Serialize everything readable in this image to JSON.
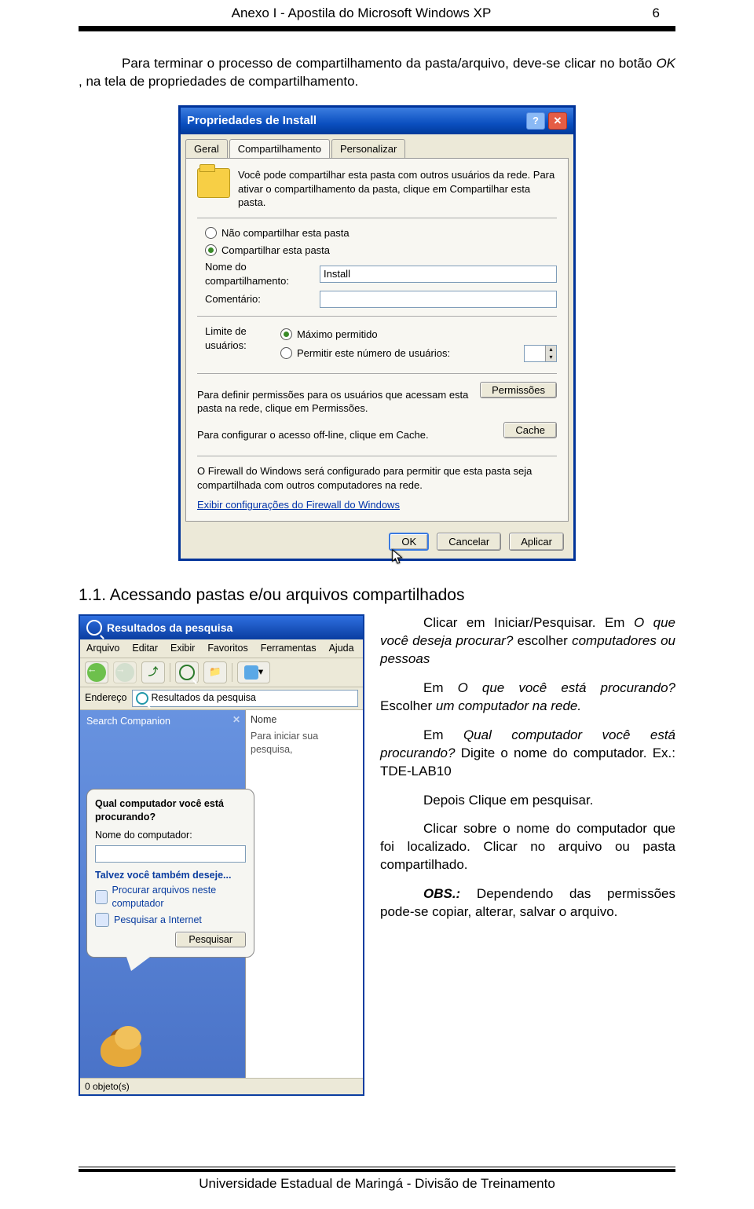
{
  "header": {
    "title": "Anexo I - Apostila do Microsoft Windows XP",
    "page": "6"
  },
  "intro": {
    "line1_pre": "Para terminar o processo de compartilhamento da pasta/arquivo, deve-se clicar no botão ",
    "line1_ok": "OK",
    "line1_post": ", na tela de propriedades de compartilhamento."
  },
  "dialog": {
    "title": "Propriedades de Install",
    "tabs": {
      "geral": "Geral",
      "compart": "Compartilhamento",
      "personal": "Personalizar"
    },
    "desc": "Você pode compartilhar esta pasta com outros usuários da rede. Para ativar o compartilhamento da pasta, clique em Compartilhar esta pasta.",
    "radio_no": "Não compartilhar esta pasta",
    "radio_yes": "Compartilhar esta pasta",
    "lbl_nome": "Nome do compartilhamento:",
    "val_nome": "Install",
    "lbl_coment": "Comentário:",
    "lbl_limite": "Limite de usuários:",
    "radio_max": "Máximo permitido",
    "radio_num": "Permitir este número de usuários:",
    "perm_text": "Para definir permissões para os usuários que acessam esta pasta na rede, clique em Permissões.",
    "btn_perm": "Permissões",
    "cache_text": "Para configurar o acesso off-line, clique em Cache.",
    "btn_cache": "Cache",
    "fw_text": "O Firewall do Windows será configurado para permitir que esta pasta seja compartilhada com outros computadores na rede.",
    "fw_link": "Exibir configurações do Firewall do Windows",
    "btn_ok": "OK",
    "btn_cancel": "Cancelar",
    "btn_apply": "Aplicar"
  },
  "h2": "1.1. Acessando pastas e/ou arquivos compartilhados",
  "search": {
    "title": "Resultados da pesquisa",
    "menu": {
      "arquivo": "Arquivo",
      "editar": "Editar",
      "exibir": "Exibir",
      "favoritos": "Favoritos",
      "ferramentas": "Ferramentas",
      "ajuda": "Ajuda"
    },
    "addr_label": "Endereço",
    "addr_value": "Resultados da pesquisa",
    "side_label": "Search Companion",
    "main_hdr": "Nome",
    "main_hint": "Para iniciar sua pesquisa,",
    "balloon": {
      "q": "Qual computador você está procurando?",
      "lbl": "Nome do computador:",
      "also": "Talvez você também deseje...",
      "opt1": "Procurar arquivos neste computador",
      "opt2": "Pesquisar a Internet",
      "btn": "Pesquisar"
    },
    "status": "0 objeto(s)"
  },
  "right": {
    "p1a": "Clicar em Iniciar/Pesquisar. Em ",
    "p1b": "O que você deseja procurar?",
    "p1c": " escolher ",
    "p1d": "computadores ou pessoas",
    "p2a": "Em ",
    "p2b": "O que você está procurando?",
    "p2c": " Escolher ",
    "p2d": "um computador na rede.",
    "p3a": "Em ",
    "p3b": "Qual computador você está procurando?",
    "p3c": " Digite o nome do computador. Ex.: TDE-LAB10",
    "p4": "Depois Clique em pesquisar.",
    "p5": "Clicar sobre o nome do computador que foi localizado. Clicar no arquivo ou pasta compartilhado.",
    "p6a": "OBS.:",
    "p6b": " Dependendo das permissões pode-se copiar, alterar, salvar o arquivo."
  },
  "footer": "Universidade Estadual de Maringá - Divisão de Treinamento"
}
